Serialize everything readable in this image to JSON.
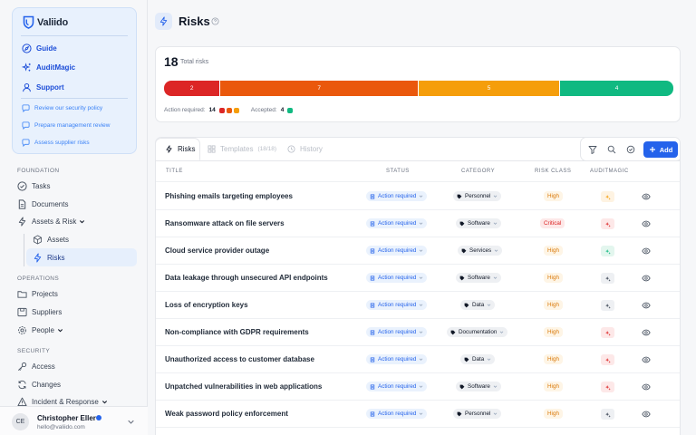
{
  "sidebar": {
    "brand": "Valiido",
    "card_nav": [
      {
        "label": "Guide",
        "icon": "compass-icon"
      },
      {
        "label": "AuditMagic",
        "icon": "sparkles-icon"
      },
      {
        "label": "Support",
        "icon": "user-icon"
      }
    ],
    "card_links": [
      {
        "label": "Review our security policy",
        "icon": "chat-icon"
      },
      {
        "label": "Prepare management review",
        "icon": "chat-icon"
      },
      {
        "label": "Assess supplier risks",
        "icon": "chat-icon"
      }
    ],
    "sections": [
      {
        "title": "FOUNDATION",
        "items": [
          "Tasks",
          "Documents",
          "Assets & Risk",
          "Assets",
          "Risks"
        ]
      },
      {
        "title": "OPERATIONS",
        "items": [
          "Projects",
          "Suppliers",
          "People"
        ]
      },
      {
        "title": "SECURITY",
        "items": [
          "Access",
          "Changes",
          "Incident & Response"
        ]
      }
    ],
    "active_item": "Risks",
    "user": {
      "initials": "CE",
      "name": "Christopher Eller",
      "email": "hello@valiido.com"
    }
  },
  "header": {
    "title": "Risks"
  },
  "summary": {
    "total": "18",
    "total_label": "Total risks",
    "segments": [
      {
        "value": 2,
        "label": "2",
        "color": "#dc2626"
      },
      {
        "value": 7,
        "label": "7",
        "color": "#ea580c"
      },
      {
        "value": 5,
        "label": "5",
        "color": "#f59e0b"
      },
      {
        "value": 4,
        "label": "4",
        "color": "#10b981"
      }
    ],
    "action_required_label": "Action required:",
    "action_required_count": "14",
    "accepted_label": "Accepted:",
    "accepted_count": "4"
  },
  "tabs": [
    {
      "label": "Risks",
      "active": true
    },
    {
      "label": "Templates",
      "count": "(18/18)",
      "active": false
    },
    {
      "label": "History",
      "active": false
    }
  ],
  "toolbar": {
    "add_label": "Add"
  },
  "table": {
    "columns": [
      "TITLE",
      "STATUS",
      "CATEGORY",
      "RISK CLASS",
      "AUDITMAGIC"
    ],
    "rows": [
      {
        "title": "Phishing emails targeting employees",
        "status": "Action required",
        "category": "Personnel",
        "risk_class": "High",
        "am_color": "#f59e0b"
      },
      {
        "title": "Ransomware attack on file servers",
        "status": "Action required",
        "category": "Software",
        "risk_class": "Critical",
        "am_color": "#dc2626"
      },
      {
        "title": "Cloud service provider outage",
        "status": "Action required",
        "category": "Services",
        "risk_class": "High",
        "am_color": "#10b981"
      },
      {
        "title": "Data leakage through unsecured API endpoints",
        "status": "Action required",
        "category": "Software",
        "risk_class": "High",
        "am_color": "#374151"
      },
      {
        "title": "Loss of encryption keys",
        "status": "Action required",
        "category": "Data",
        "risk_class": "High",
        "am_color": "#374151"
      },
      {
        "title": "Non-compliance with GDPR requirements",
        "status": "Action required",
        "category": "Documentation",
        "risk_class": "High",
        "am_color": "#dc2626"
      },
      {
        "title": "Unauthorized access to customer database",
        "status": "Action required",
        "category": "Data",
        "risk_class": "High",
        "am_color": "#dc2626"
      },
      {
        "title": "Unpatched vulnerabilities in web applications",
        "status": "Action required",
        "category": "Software",
        "risk_class": "High",
        "am_color": "#dc2626"
      },
      {
        "title": "Weak password policy enforcement",
        "status": "Action required",
        "category": "Personnel",
        "risk_class": "High",
        "am_color": "#374151"
      }
    ]
  }
}
